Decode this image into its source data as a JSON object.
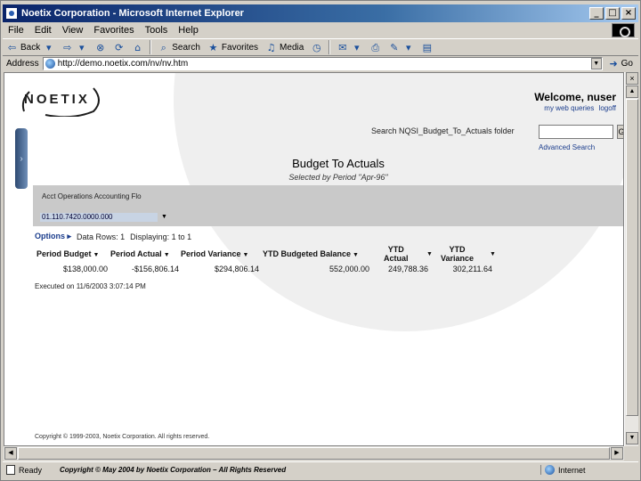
{
  "window": {
    "title": "Noetix Corporation - Microsoft Internet Explorer",
    "controls": [
      "_",
      "□",
      "×"
    ]
  },
  "menubar": {
    "items": [
      "File",
      "Edit",
      "View",
      "Favorites",
      "Tools",
      "Help"
    ]
  },
  "toolbar": {
    "back": "Back",
    "search": "Search",
    "favorites": "Favorites",
    "media": "Media"
  },
  "address": {
    "label": "Address",
    "url": "http://demo.noetix.com/nv/nv.htm",
    "go": "Go"
  },
  "page": {
    "logo": "NOETIX",
    "welcome": "Welcome, nuser",
    "links": [
      "my web queries",
      "logoff"
    ],
    "search_label": "Search NQSI_Budget_To_Actuals folder",
    "search_value": "",
    "search_go": "G",
    "advanced_search": "Advanced Search",
    "report_title": "Budget To Actuals",
    "report_subtitle": "Selected by Period \"Apr-96\"",
    "param_label": "Acct Operations Accounting Flo",
    "param_value": "01.110.7420.0000.000",
    "options": "Options",
    "data_rows": "Data Rows: 1",
    "displaying": "Displaying: 1 to 1",
    "columns": {
      "period_budget": "Period Budget",
      "period_actual": "Period Actual",
      "period_variance": "Period Variance",
      "ytd_budgeted": "YTD Budgeted Balance",
      "ytd_actual_1": "YTD",
      "ytd_actual_2": "Actual",
      "ytd_variance_1": "YTD",
      "ytd_variance_2": "Variance"
    },
    "row": {
      "period_budget": "$138,000.00",
      "period_actual": "-$156,806.14",
      "period_variance": "$294,806.14",
      "ytd_budgeted": "552,000.00",
      "ytd_actual": "249,788.36",
      "ytd_variance": "302,211.64"
    },
    "executed": "Executed on 11/6/2003 3:07:14 PM",
    "copyright": "Copyright © 1999-2003, Noetix Corporation. All rights reserved."
  },
  "statusbar": {
    "ready": "Ready",
    "copyright": "Copyright © May 2004 by Noetix Corporation – All Rights Reserved",
    "zone": "Internet"
  }
}
